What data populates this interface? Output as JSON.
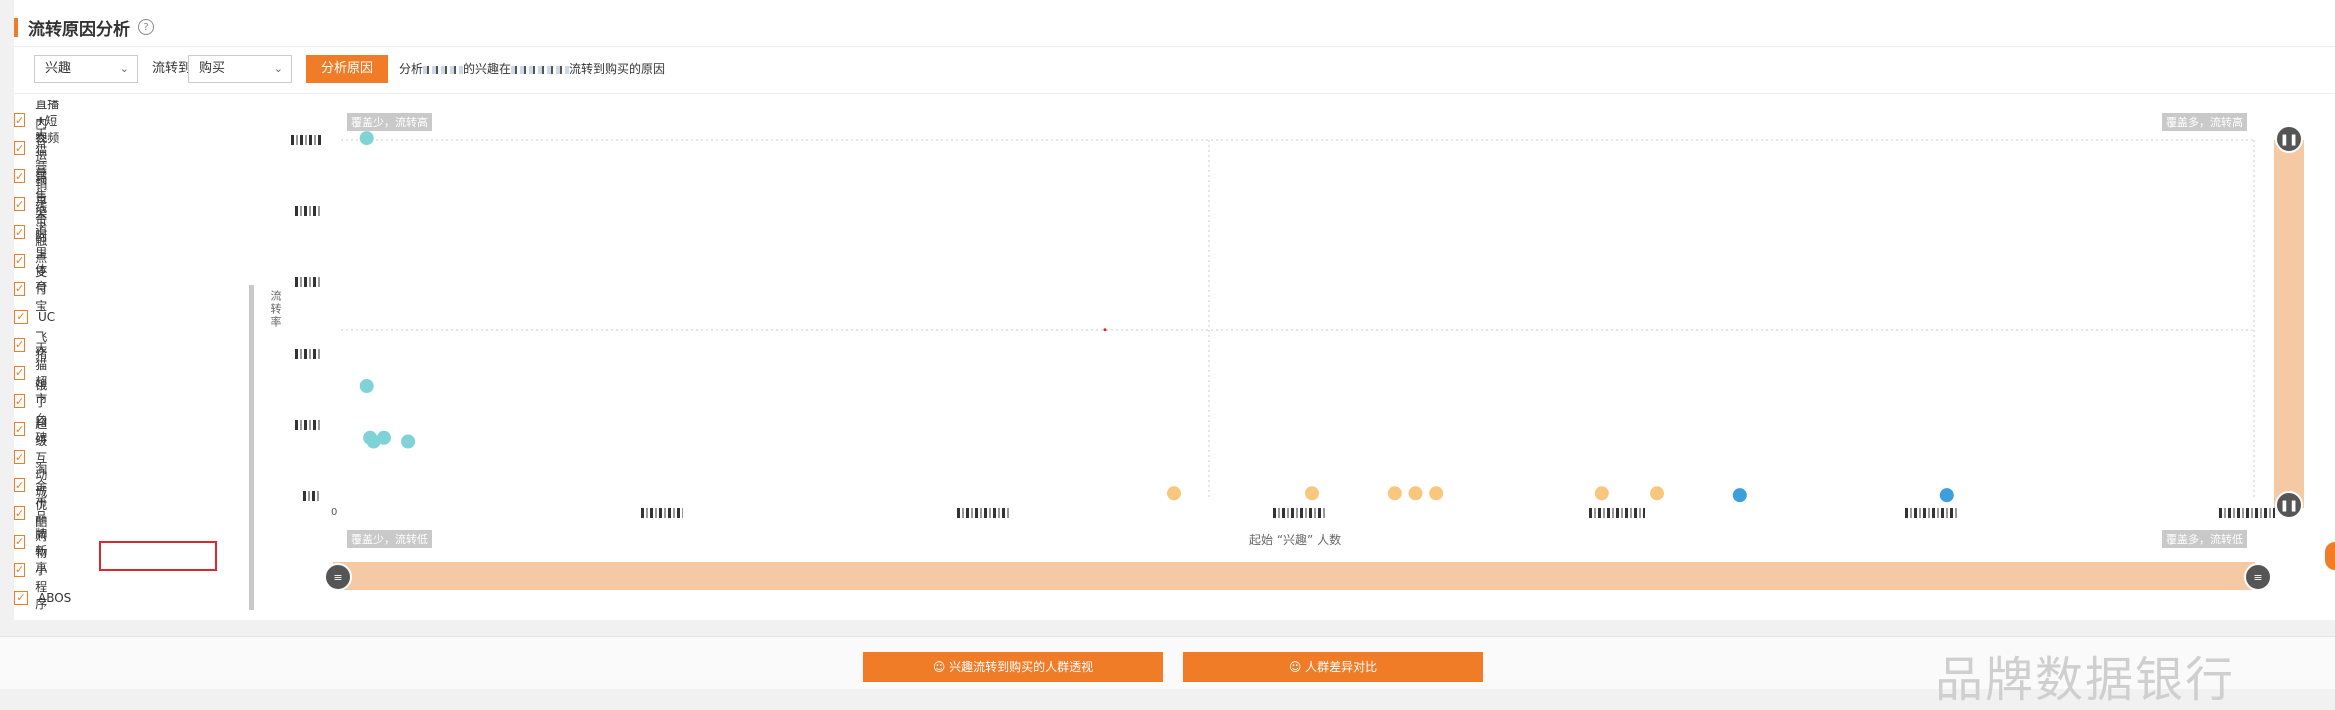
{
  "header": {
    "title": "流转原因分析",
    "help_icon": "question-circle-icon"
  },
  "toolbar": {
    "from_select": {
      "value": "兴趣"
    },
    "to_label": "流转到",
    "to_select": {
      "value": "购买"
    },
    "analyze_button": "分析原因",
    "analysis_prefix": "分析",
    "analysis_mid": "的兴趣在",
    "analysis_suffix": "流转到购买的原因"
  },
  "sidebar": {
    "items": [
      {
        "label": "直播+短视频",
        "checked": true
      },
      {
        "label": "内容运营",
        "checked": true
      },
      {
        "label": "天猫营销平台",
        "checked": true
      },
      {
        "label": "销售渠道",
        "checked": true
      },
      {
        "label": "线下触点",
        "checked": true
      },
      {
        "label": "阿里体育",
        "checked": true
      },
      {
        "label": "支付宝",
        "checked": true
      },
      {
        "label": "UC",
        "checked": true
      },
      {
        "label": "飞猪",
        "checked": true
      },
      {
        "label": "天猫超市",
        "checked": true
      },
      {
        "label": "饿了么",
        "checked": true
      },
      {
        "label": "口碑",
        "checked": true
      },
      {
        "label": "超级互动城",
        "checked": true,
        "highlighted": true
      },
      {
        "label": "淘金币",
        "checked": true
      },
      {
        "label": "优酷",
        "checked": true
      },
      {
        "label": "品牌新享",
        "checked": true
      },
      {
        "label": "购物小程序",
        "checked": true
      },
      {
        "label": "ABOS",
        "checked": true
      }
    ]
  },
  "chart": {
    "y_axis_title": "流转率",
    "x_axis_title": "起始 “兴趣” 人数",
    "quadrants": {
      "top_left": "覆盖少，流转高",
      "top_right": "覆盖多，流转高",
      "bottom_left": "覆盖少，流转低",
      "bottom_right": "覆盖多，流转低"
    },
    "x_origin_label": "0",
    "colors": {
      "teal": "#7fd3d6",
      "orange": "#f8c77e",
      "blue": "#3a9fdc",
      "slider": "#f6c9a5",
      "accent": "#f07c28"
    }
  },
  "chart_data": {
    "type": "scatter",
    "xlabel": "起始 “兴趣” 人数",
    "ylabel": "流转率",
    "grid": false,
    "series": [
      {
        "color": "#7fd3d6",
        "points": [
          [
            0.03,
            0.97
          ],
          [
            0.03,
            0.3
          ],
          [
            0.035,
            0.16
          ],
          [
            0.04,
            0.15
          ],
          [
            0.055,
            0.16
          ],
          [
            0.09,
            0.15
          ]
        ]
      },
      {
        "color": "#f8c77e",
        "points": [
          [
            1.2,
            0.01
          ],
          [
            1.4,
            0.01
          ],
          [
            1.52,
            0.01
          ],
          [
            1.55,
            0.01
          ],
          [
            1.58,
            0.01
          ],
          [
            1.82,
            0.01
          ],
          [
            1.9,
            0.01
          ]
        ]
      },
      {
        "color": "#3a9fdc",
        "points": [
          [
            2.02,
            0.005
          ],
          [
            2.32,
            0.005
          ]
        ]
      }
    ],
    "marker": {
      "color": "#d9292e",
      "x": 1.1,
      "y": 0.46
    }
  },
  "actions": {
    "perspective_button": "兴趣流转到购买的人群透视",
    "compare_button": "人群差异对比"
  },
  "watermark": "品牌数据银行"
}
